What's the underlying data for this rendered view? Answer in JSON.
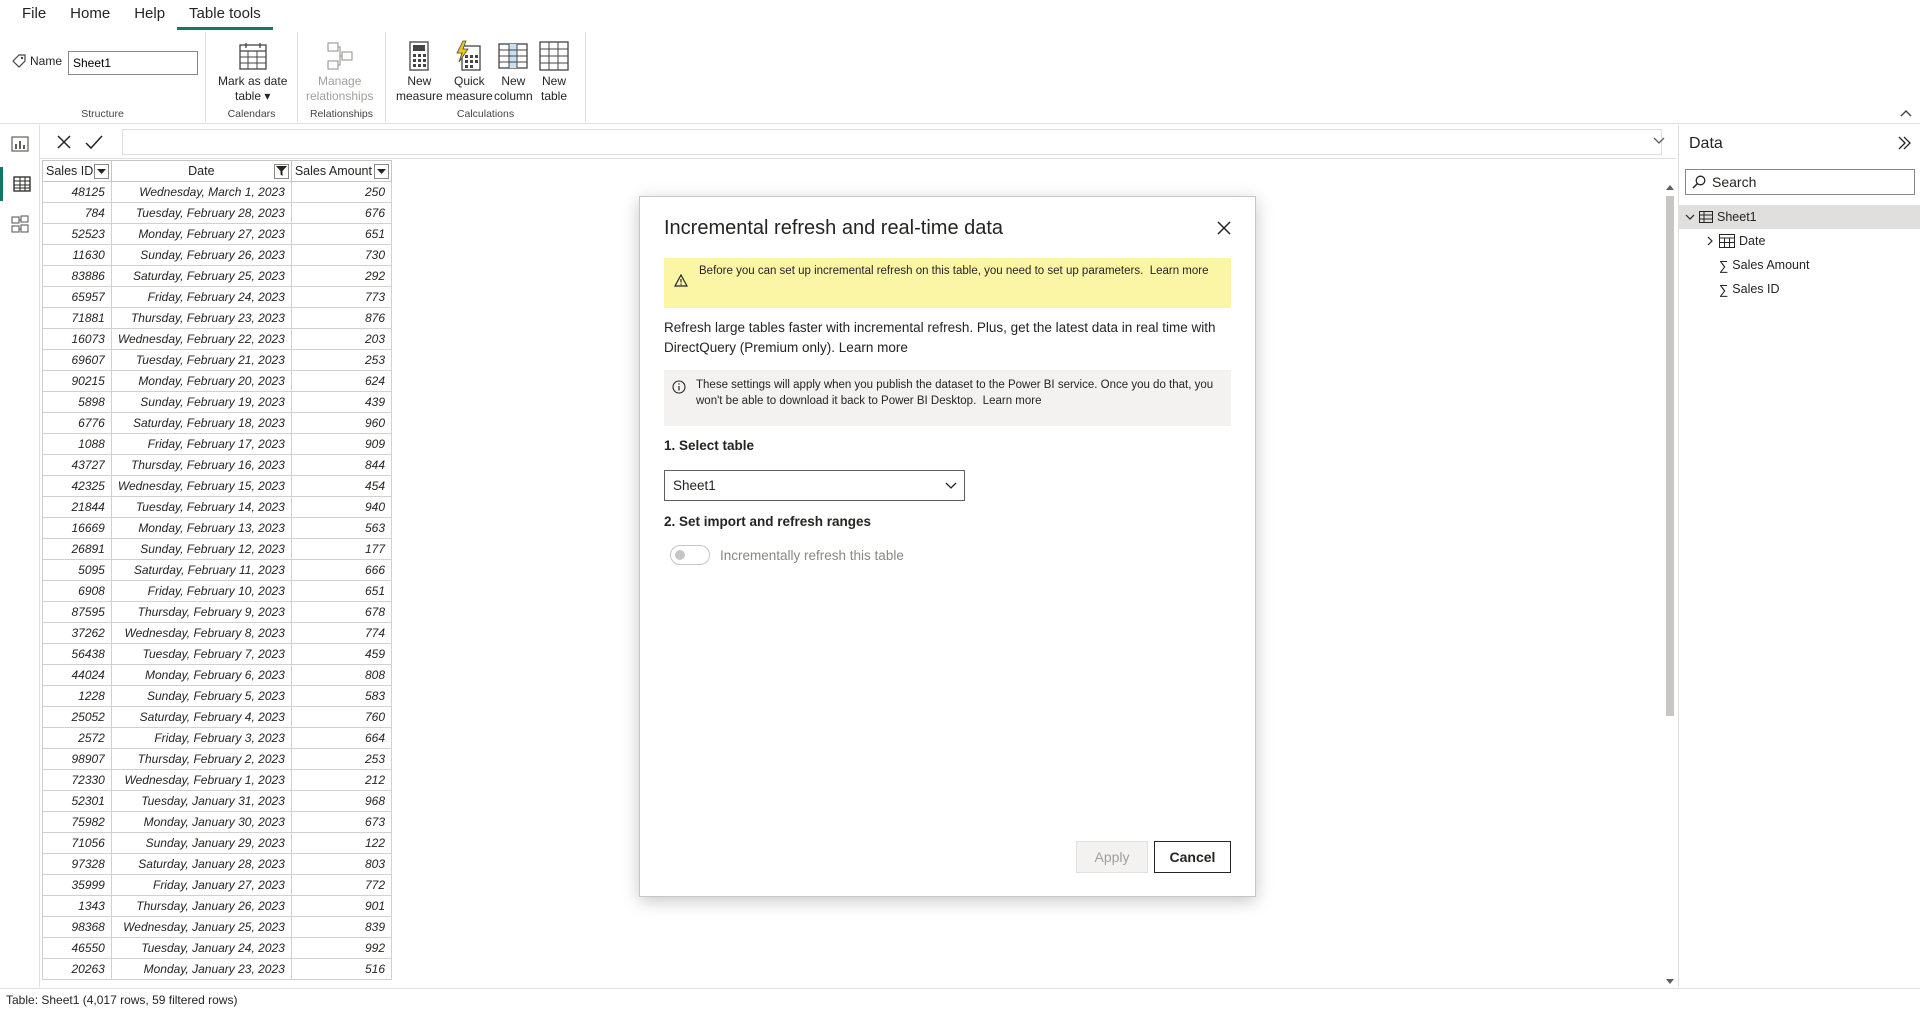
{
  "menubar": {
    "items": [
      {
        "label": "File"
      },
      {
        "label": "Home"
      },
      {
        "label": "Help"
      },
      {
        "label": "Table tools"
      }
    ]
  },
  "ribbon": {
    "structure": {
      "name_label": "Name",
      "name_value": "Sheet1",
      "group_label": "Structure"
    },
    "calendars": {
      "mark_as_date_line1": "Mark as date",
      "mark_as_date_line2": "table",
      "group_label": "Calendars"
    },
    "relationships": {
      "manage_line1": "Manage",
      "manage_line2": "relationships",
      "group_label": "Relationships"
    },
    "calculations": {
      "new_measure_line1": "New",
      "new_measure_line2": "measure",
      "quick_measure_line1": "Quick",
      "quick_measure_line2": "measure",
      "new_column_line1": "New",
      "new_column_line2": "column",
      "new_table_line1": "New",
      "new_table_line2": "table",
      "group_label": "Calculations"
    }
  },
  "table": {
    "headers": [
      "Sales ID",
      "Date",
      "Sales Amount"
    ],
    "rows": [
      [
        "48125",
        "Wednesday, March 1, 2023",
        "250"
      ],
      [
        "784",
        "Tuesday, February 28, 2023",
        "676"
      ],
      [
        "52523",
        "Monday, February 27, 2023",
        "651"
      ],
      [
        "11630",
        "Sunday, February 26, 2023",
        "730"
      ],
      [
        "83886",
        "Saturday, February 25, 2023",
        "292"
      ],
      [
        "65957",
        "Friday, February 24, 2023",
        "773"
      ],
      [
        "71881",
        "Thursday, February 23, 2023",
        "876"
      ],
      [
        "16073",
        "Wednesday, February 22, 2023",
        "203"
      ],
      [
        "69607",
        "Tuesday, February 21, 2023",
        "253"
      ],
      [
        "90215",
        "Monday, February 20, 2023",
        "624"
      ],
      [
        "5898",
        "Sunday, February 19, 2023",
        "439"
      ],
      [
        "6776",
        "Saturday, February 18, 2023",
        "960"
      ],
      [
        "1088",
        "Friday, February 17, 2023",
        "909"
      ],
      [
        "43727",
        "Thursday, February 16, 2023",
        "844"
      ],
      [
        "42325",
        "Wednesday, February 15, 2023",
        "454"
      ],
      [
        "21844",
        "Tuesday, February 14, 2023",
        "940"
      ],
      [
        "16669",
        "Monday, February 13, 2023",
        "563"
      ],
      [
        "26891",
        "Sunday, February 12, 2023",
        "177"
      ],
      [
        "5095",
        "Saturday, February 11, 2023",
        "666"
      ],
      [
        "6908",
        "Friday, February 10, 2023",
        "651"
      ],
      [
        "87595",
        "Thursday, February 9, 2023",
        "678"
      ],
      [
        "37262",
        "Wednesday, February 8, 2023",
        "774"
      ],
      [
        "56438",
        "Tuesday, February 7, 2023",
        "459"
      ],
      [
        "44024",
        "Monday, February 6, 2023",
        "808"
      ],
      [
        "1228",
        "Sunday, February 5, 2023",
        "583"
      ],
      [
        "25052",
        "Saturday, February 4, 2023",
        "760"
      ],
      [
        "2572",
        "Friday, February 3, 2023",
        "664"
      ],
      [
        "98907",
        "Thursday, February 2, 2023",
        "253"
      ],
      [
        "72330",
        "Wednesday, February 1, 2023",
        "212"
      ],
      [
        "52301",
        "Tuesday, January 31, 2023",
        "968"
      ],
      [
        "75982",
        "Monday, January 30, 2023",
        "673"
      ],
      [
        "71056",
        "Sunday, January 29, 2023",
        "122"
      ],
      [
        "97328",
        "Saturday, January 28, 2023",
        "803"
      ],
      [
        "35999",
        "Friday, January 27, 2023",
        "772"
      ],
      [
        "1343",
        "Thursday, January 26, 2023",
        "901"
      ],
      [
        "98368",
        "Wednesday, January 25, 2023",
        "839"
      ],
      [
        "46550",
        "Tuesday, January 24, 2023",
        "992"
      ],
      [
        "20263",
        "Monday, January 23, 2023",
        "516"
      ]
    ]
  },
  "datapane": {
    "title": "Data",
    "search_placeholder": "Search",
    "table_name": "Sheet1",
    "fields": [
      "Date",
      "Sales Amount",
      "Sales ID"
    ]
  },
  "statusbar": {
    "text": "Table: Sheet1 (4,017 rows, 59 filtered rows)"
  },
  "dialog": {
    "title": "Incremental refresh and real-time data",
    "warning_text": "Before you can set up incremental refresh on this table, you need to set up parameters.",
    "warning_link": "Learn more",
    "description": "Refresh large tables faster with incremental refresh. Plus, get the latest data in real time with DirectQuery (Premium only).",
    "description_link": "Learn more",
    "info_text": "These settings will apply when you publish the dataset to the Power BI service. Once you do that, you won't be able to download it back to Power BI Desktop.",
    "info_link": "Learn more",
    "section1": "1. Select table",
    "selected_table": "Sheet1",
    "section2": "2. Set import and refresh ranges",
    "toggle_label": "Incrementally refresh this table",
    "apply_label": "Apply",
    "cancel_label": "Cancel"
  },
  "colors": {
    "accent": "#117865",
    "warning_bg": "#fbf6a6",
    "info_bg": "#f3f2f1"
  }
}
